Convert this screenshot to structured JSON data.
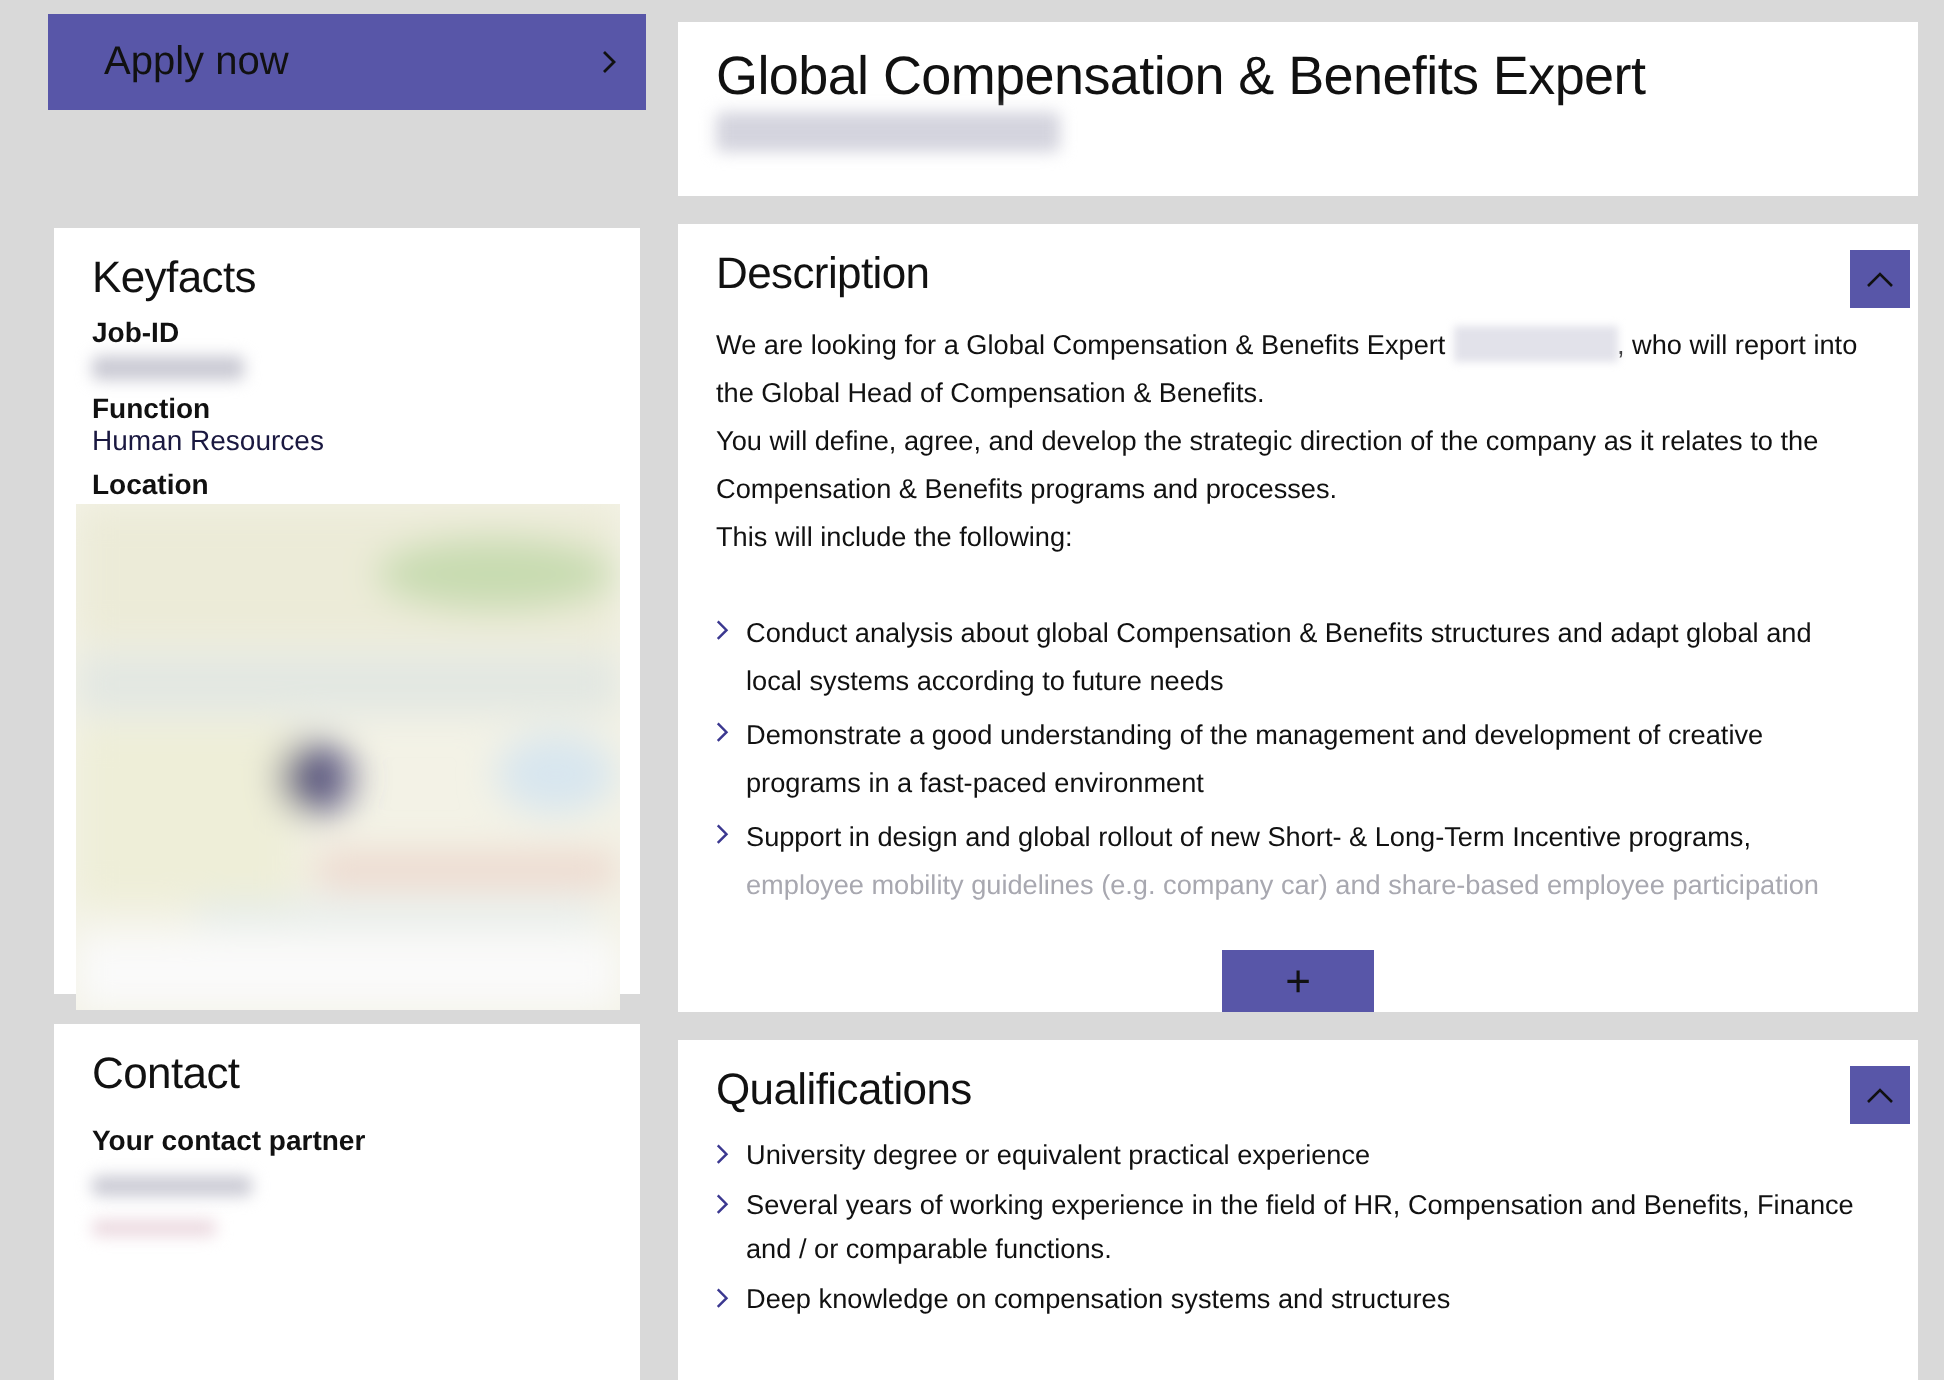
{
  "apply_button": {
    "label": "Apply now"
  },
  "header": {
    "title": "Global Compensation & Benefits Expert"
  },
  "keyfacts": {
    "title": "Keyfacts",
    "facts": [
      {
        "kind": "blurred",
        "label": "Job-ID"
      },
      {
        "kind": "text",
        "label": "Function",
        "value": "Human Resources"
      },
      {
        "kind": "map",
        "label": "Location"
      }
    ]
  },
  "contact": {
    "title": "Contact",
    "subtitle": "Your contact partner"
  },
  "description": {
    "title": "Description",
    "expand_icon": "+",
    "intro": [
      {
        "text": "We are looking for a Global Compensation & Benefits Expert",
        "after": ", who will report into the Global Head of Compensation & Benefits."
      },
      {
        "text": "You will define, agree, and develop the strategic direction of the company as it relates to the Compensation & Benefits programs and processes."
      },
      {
        "text": "This will include the following:"
      }
    ],
    "bullets": [
      {
        "text": "Conduct analysis about global Compensation & Benefits structures and adapt global and local systems according to future needs"
      },
      {
        "text": "Demonstrate a good understanding of the management and development of creative programs in a fast-paced environment"
      },
      {
        "text": "Support in design and global rollout of new Short- & Long-Term Incentive programs,",
        "faded": "employee mobility guidelines (e.g. company car) and share-based employee participation"
      }
    ]
  },
  "qualifications": {
    "title": "Qualifications",
    "bullets": [
      {
        "text": "University degree or equivalent practical experience"
      },
      {
        "text": "Several years of working experience in the field of HR, Compensation and Benefits, Finance and / or comparable functions."
      },
      {
        "text": "Deep knowledge on compensation systems and structures"
      }
    ]
  }
}
